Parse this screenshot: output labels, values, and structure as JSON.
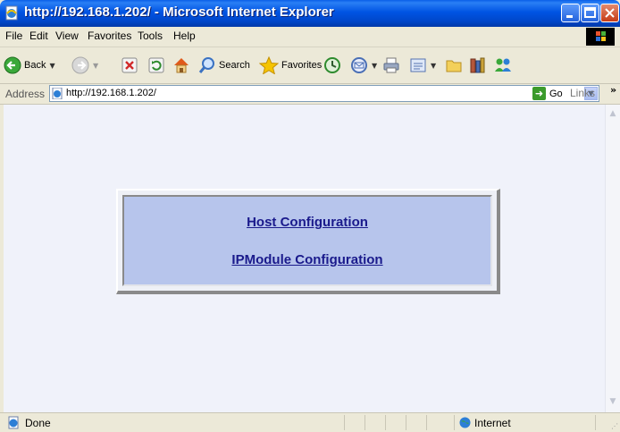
{
  "window": {
    "title": "http://192.168.1.202/ - Microsoft Internet Explorer"
  },
  "menu": {
    "items": [
      "File",
      "Edit",
      "View",
      "Favorites",
      "Tools",
      "Help"
    ]
  },
  "toolbar": {
    "back_label": "Back",
    "search_label": "Search",
    "favorites_label": "Favorites"
  },
  "address": {
    "label": "Address",
    "url": "http://192.168.1.202/",
    "go_label": "Go",
    "links_label": "Links",
    "links_chevron": "»"
  },
  "content": {
    "links": [
      "Host Configuration",
      "IPModule Configuration"
    ]
  },
  "status": {
    "text": "Done",
    "zone": "Internet"
  },
  "colors": {
    "titlebar": "#0054e3",
    "panel_fill": "#b7c5ec",
    "link": "#1a1a8c",
    "page_background": "#f0f2fa"
  }
}
